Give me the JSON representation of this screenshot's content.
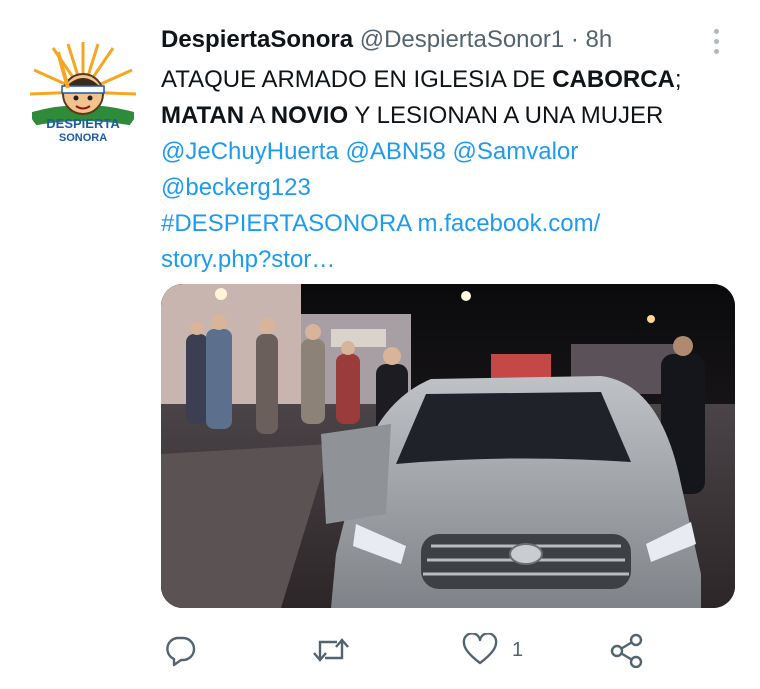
{
  "tweet": {
    "display_name": "DespiertaSonora",
    "handle": "@DespiertaSonor1",
    "separator": "·",
    "time": "8h",
    "avatar_text_top": "DESPIERTA",
    "avatar_text_bottom": "SONORA",
    "text": {
      "l1_a": "ATAQUE ARMADO EN IGLESIA DE ",
      "l1_b": "CABORCA",
      "l1_c": ";",
      "l2_a": "MATAN",
      "l2_b": " A ",
      "l2_c": "NOVIO",
      "l2_d": " Y LESIONAN A UNA MUJER",
      "mention1": "@JeChuyHuerta",
      "mention2": "@ABN58",
      "mention3": "@Samvalor",
      "mention4": "@beckerg123",
      "hashtag": "#DESPIERTASONORA",
      "link1": "m.facebook.com/",
      "link2": "story.php?stor…"
    }
  },
  "actions": {
    "reply_icon": "reply-icon",
    "retweet_icon": "retweet-icon",
    "like_icon": "heart-icon",
    "like_count": "1",
    "share_icon": "share-icon"
  },
  "colors": {
    "link": "#1d9bf0",
    "text": "#0f1419",
    "muted": "#536471"
  }
}
